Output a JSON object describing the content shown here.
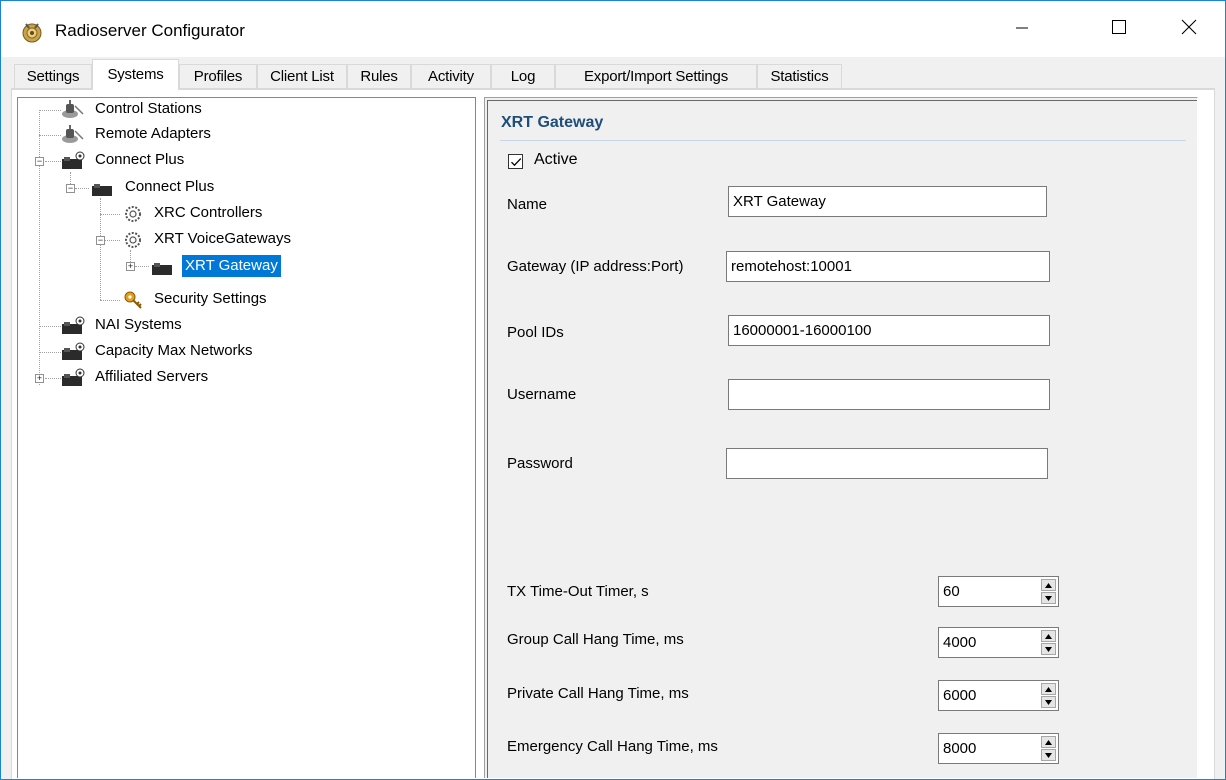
{
  "window": {
    "title": "Radioserver Configurator",
    "controls": {
      "minimize": "minimize",
      "maximize": "maximize",
      "close": "close"
    }
  },
  "tabs": [
    {
      "label": "Settings"
    },
    {
      "label": "Systems",
      "active": true
    },
    {
      "label": "Profiles"
    },
    {
      "label": "Client List"
    },
    {
      "label": "Rules"
    },
    {
      "label": "Activity"
    },
    {
      "label": "Log"
    },
    {
      "label": "Export/Import Settings"
    },
    {
      "label": "Statistics"
    }
  ],
  "tree": {
    "nodes": [
      {
        "label": "Control Stations",
        "icon": "radio-station-icon"
      },
      {
        "label": "Remote Adapters",
        "icon": "radio-station-icon"
      },
      {
        "label": "Connect Plus",
        "icon": "radio-system-icon",
        "expanded": true
      },
      {
        "label": "Connect Plus",
        "icon": "radio-system-icon",
        "expanded": true
      },
      {
        "label": "XRC Controllers",
        "icon": "gear-icon"
      },
      {
        "label": "XRT VoiceGateways",
        "icon": "gear-icon",
        "expanded": true
      },
      {
        "label": "XRT Gateway",
        "icon": "radio-system-icon",
        "expanded": false,
        "selected": true
      },
      {
        "label": "Security Settings",
        "icon": "key-icon"
      },
      {
        "label": "NAI Systems",
        "icon": "radio-system-icon"
      },
      {
        "label": "Capacity Max Networks",
        "icon": "radio-system-icon"
      },
      {
        "label": "Affiliated Servers",
        "icon": "radio-system-icon",
        "expanded": false
      }
    ]
  },
  "detail": {
    "title": "XRT Gateway",
    "active": {
      "label": "Active",
      "checked": true
    },
    "fields": {
      "name": {
        "label": "Name",
        "value": "XRT Gateway"
      },
      "gateway": {
        "label": "Gateway (IP address:Port)",
        "value": "remotehost:10001"
      },
      "pool_ids": {
        "label": "Pool IDs",
        "value": "16000001-16000100"
      },
      "username": {
        "label": "Username",
        "value": ""
      },
      "password": {
        "label": "Password",
        "value": ""
      }
    },
    "spinners": {
      "tx_timeout": {
        "label": "TX Time-Out Timer, s",
        "value": "60"
      },
      "group_hang": {
        "label": "Group Call Hang Time, ms",
        "value": "4000"
      },
      "private_hang": {
        "label": "Private Call Hang Time, ms",
        "value": "6000"
      },
      "emergency_hang": {
        "label": "Emergency Call Hang Time, ms",
        "value": "8000"
      }
    }
  },
  "colors": {
    "accent": "#0078d7",
    "section_title": "#1e4e79",
    "window_border": "#1883d7"
  }
}
